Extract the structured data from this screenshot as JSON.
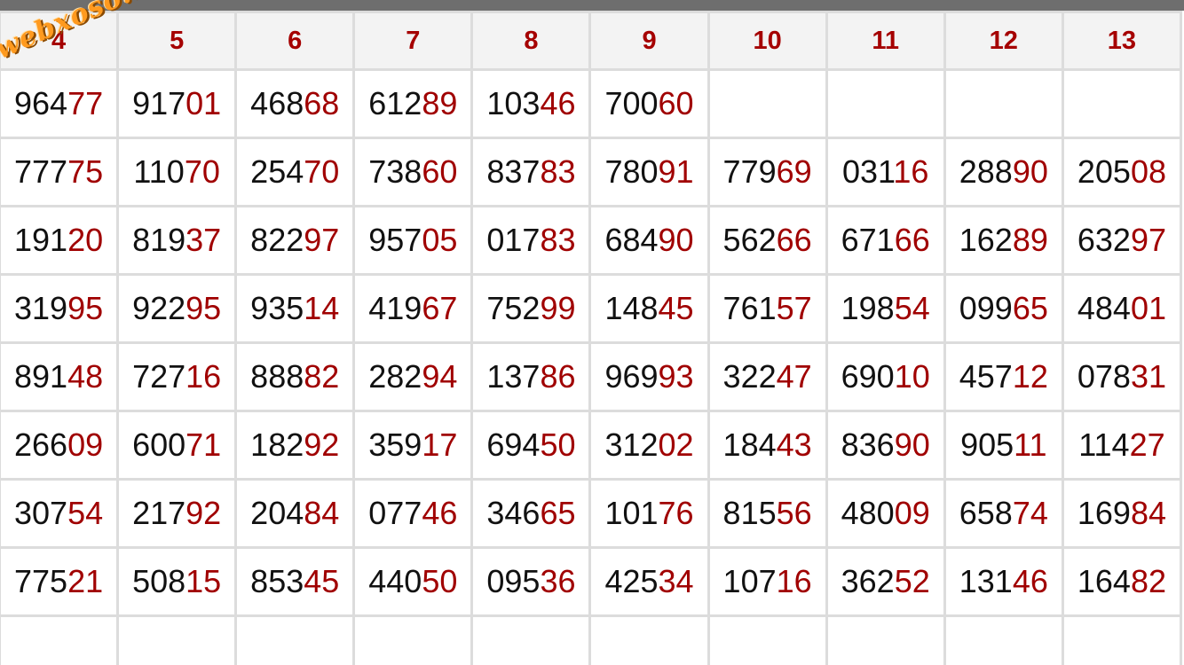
{
  "watermark": "webxoso.net",
  "columns": [
    "4",
    "5",
    "6",
    "7",
    "8",
    "9",
    "10",
    "11",
    "12",
    "13"
  ],
  "rows": [
    [
      {
        "head": "964",
        "tail": "77",
        "hl": "green"
      },
      {
        "head": "917",
        "tail": "01",
        "hl": ""
      },
      {
        "head": "468",
        "tail": "68",
        "hl": ""
      },
      {
        "head": "612",
        "tail": "89",
        "hl": ""
      },
      {
        "head": "103",
        "tail": "46",
        "hl": ""
      },
      {
        "head": "700",
        "tail": "60",
        "hl": "orange"
      },
      {
        "head": "",
        "tail": "",
        "hl": "orange"
      },
      {
        "head": "",
        "tail": "",
        "hl": "green"
      },
      {
        "head": "",
        "tail": "",
        "hl": ""
      },
      {
        "head": "",
        "tail": "",
        "hl": ""
      }
    ],
    [
      {
        "head": "777",
        "tail": "75",
        "hl": ""
      },
      {
        "head": "110",
        "tail": "70",
        "hl": "green"
      },
      {
        "head": "254",
        "tail": "70",
        "hl": ""
      },
      {
        "head": "738",
        "tail": "60",
        "hl": ""
      },
      {
        "head": "837",
        "tail": "83",
        "hl": "orange"
      },
      {
        "head": "780",
        "tail": "91",
        "hl": ""
      },
      {
        "head": "779",
        "tail": "69",
        "hl": ""
      },
      {
        "head": "031",
        "tail": "16",
        "hl": ""
      },
      {
        "head": "288",
        "tail": "90",
        "hl": "green"
      },
      {
        "head": "205",
        "tail": "08",
        "hl": ""
      }
    ],
    [
      {
        "head": "191",
        "tail": "20",
        "hl": ""
      },
      {
        "head": "819",
        "tail": "37",
        "hl": ""
      },
      {
        "head": "822",
        "tail": "97",
        "hl": ""
      },
      {
        "head": "957",
        "tail": "05",
        "hl": "green"
      },
      {
        "head": "017",
        "tail": "83",
        "hl": ""
      },
      {
        "head": "684",
        "tail": "90",
        "hl": ""
      },
      {
        "head": "562",
        "tail": "66",
        "hl": ""
      },
      {
        "head": "671",
        "tail": "66",
        "hl": ""
      },
      {
        "head": "162",
        "tail": "89",
        "hl": ""
      },
      {
        "head": "632",
        "tail": "97",
        "hl": ""
      }
    ],
    [
      {
        "head": "319",
        "tail": "95",
        "hl": ""
      },
      {
        "head": "922",
        "tail": "95",
        "hl": ""
      },
      {
        "head": "935",
        "tail": "14",
        "hl": ""
      },
      {
        "head": "419",
        "tail": "67",
        "hl": ""
      },
      {
        "head": "752",
        "tail": "99",
        "hl": "green"
      },
      {
        "head": "148",
        "tail": "45",
        "hl": ""
      },
      {
        "head": "761",
        "tail": "57",
        "hl": ""
      },
      {
        "head": "198",
        "tail": "54",
        "hl": ""
      },
      {
        "head": "099",
        "tail": "65",
        "hl": ""
      },
      {
        "head": "484",
        "tail": "01",
        "hl": ""
      }
    ],
    [
      {
        "head": "891",
        "tail": "48",
        "hl": ""
      },
      {
        "head": "727",
        "tail": "16",
        "hl": ""
      },
      {
        "head": "888",
        "tail": "82",
        "hl": ""
      },
      {
        "head": "282",
        "tail": "94",
        "hl": ""
      },
      {
        "head": "137",
        "tail": "86",
        "hl": ""
      },
      {
        "head": "969",
        "tail": "93",
        "hl": "green"
      },
      {
        "head": "322",
        "tail": "47",
        "hl": ""
      },
      {
        "head": "690",
        "tail": "10",
        "hl": ""
      },
      {
        "head": "457",
        "tail": "12",
        "hl": ""
      },
      {
        "head": "078",
        "tail": "31",
        "hl": ""
      }
    ],
    [
      {
        "head": "266",
        "tail": "09",
        "hl": ""
      },
      {
        "head": "600",
        "tail": "71",
        "hl": ""
      },
      {
        "head": "182",
        "tail": "92",
        "hl": ""
      },
      {
        "head": "359",
        "tail": "17",
        "hl": ""
      },
      {
        "head": "694",
        "tail": "50",
        "hl": ""
      },
      {
        "head": "312",
        "tail": "02",
        "hl": ""
      },
      {
        "head": "184",
        "tail": "43",
        "hl": "green"
      },
      {
        "head": "836",
        "tail": "90",
        "hl": ""
      },
      {
        "head": "905",
        "tail": "11",
        "hl": ""
      },
      {
        "head": "114",
        "tail": "27",
        "hl": ""
      }
    ],
    [
      {
        "head": "307",
        "tail": "54",
        "hl": ""
      },
      {
        "head": "217",
        "tail": "92",
        "hl": "green"
      },
      {
        "head": "204",
        "tail": "84",
        "hl": ""
      },
      {
        "head": "077",
        "tail": "46",
        "hl": ""
      },
      {
        "head": "346",
        "tail": "65",
        "hl": ""
      },
      {
        "head": "101",
        "tail": "76",
        "hl": ""
      },
      {
        "head": "815",
        "tail": "56",
        "hl": ""
      },
      {
        "head": "480",
        "tail": "09",
        "hl": ""
      },
      {
        "head": "658",
        "tail": "74",
        "hl": "green"
      },
      {
        "head": "169",
        "tail": "84",
        "hl": ""
      }
    ],
    [
      {
        "head": "775",
        "tail": "21",
        "hl": ""
      },
      {
        "head": "508",
        "tail": "15",
        "hl": ""
      },
      {
        "head": "853",
        "tail": "45",
        "hl": "green"
      },
      {
        "head": "440",
        "tail": "50",
        "hl": ""
      },
      {
        "head": "095",
        "tail": "36",
        "hl": ""
      },
      {
        "head": "425",
        "tail": "34",
        "hl": ""
      },
      {
        "head": "107",
        "tail": "16",
        "hl": ""
      },
      {
        "head": "362",
        "tail": "52",
        "hl": ""
      },
      {
        "head": "131",
        "tail": "46",
        "hl": ""
      },
      {
        "head": "164",
        "tail": "82",
        "hl": "green"
      }
    ]
  ],
  "partial_row": [
    {
      "head": "",
      "tail": "",
      "hl": ""
    },
    {
      "head": "",
      "tail": "",
      "hl": ""
    },
    {
      "head": "",
      "tail": "",
      "hl": ""
    },
    {
      "head": "",
      "tail": "",
      "hl": "green"
    },
    {
      "head": "",
      "tail": "",
      "hl": ""
    },
    {
      "head": "",
      "tail": "",
      "hl": ""
    },
    {
      "head": "",
      "tail": "",
      "hl": ""
    },
    {
      "head": "",
      "tail": "",
      "hl": ""
    },
    {
      "head": "",
      "tail": "",
      "hl": ""
    },
    {
      "head": "",
      "tail": "",
      "hl": ""
    }
  ],
  "colors": {
    "header_text": "#a50000",
    "tail_text": "#a00000",
    "highlight_green": "#e2f0dc",
    "highlight_orange": "#ffbf00",
    "grid": "#dcdcdc",
    "watermark": "#ff9a1f"
  }
}
